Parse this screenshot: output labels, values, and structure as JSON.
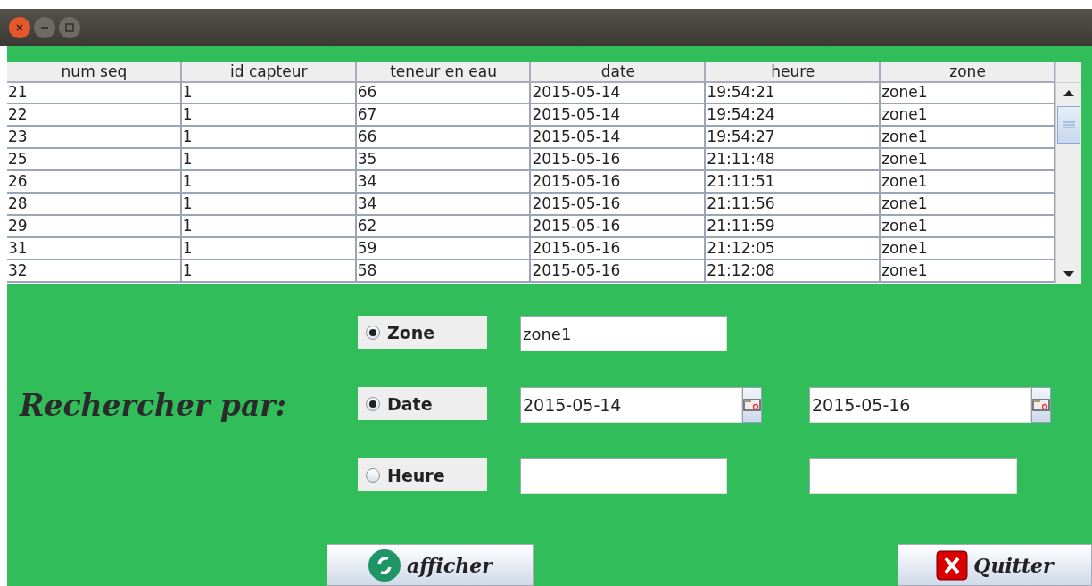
{
  "table": {
    "columns": [
      "num seq",
      "id capteur",
      "teneur en eau",
      "date",
      "heure",
      "zone"
    ],
    "rows": [
      [
        "21",
        "1",
        "66",
        "2015-05-14",
        "19:54:21",
        "zone1"
      ],
      [
        "22",
        "1",
        "67",
        "2015-05-14",
        "19:54:24",
        "zone1"
      ],
      [
        "23",
        "1",
        "66",
        "2015-05-14",
        "19:54:27",
        "zone1"
      ],
      [
        "25",
        "1",
        "35",
        "2015-05-16",
        "21:11:48",
        "zone1"
      ],
      [
        "26",
        "1",
        "34",
        "2015-05-16",
        "21:11:51",
        "zone1"
      ],
      [
        "28",
        "1",
        "34",
        "2015-05-16",
        "21:11:56",
        "zone1"
      ],
      [
        "29",
        "1",
        "62",
        "2015-05-16",
        "21:11:59",
        "zone1"
      ],
      [
        "31",
        "1",
        "59",
        "2015-05-16",
        "21:12:05",
        "zone1"
      ],
      [
        "32",
        "1",
        "58",
        "2015-05-16",
        "21:12:08",
        "zone1"
      ]
    ]
  },
  "search": {
    "label": "Rechercher par:",
    "criteria": [
      {
        "label": "Zone",
        "checked": true,
        "kind": "text",
        "values": [
          "zone1"
        ]
      },
      {
        "label": "Date",
        "checked": true,
        "kind": "date",
        "values": [
          "2015-05-14",
          "2015-05-16"
        ]
      },
      {
        "label": "Heure",
        "checked": false,
        "kind": "range"
      }
    ]
  },
  "buttons": [
    {
      "label": "afficher",
      "kind": "refresh"
    },
    {
      "label": "Quitter",
      "kind": "quit"
    }
  ]
}
